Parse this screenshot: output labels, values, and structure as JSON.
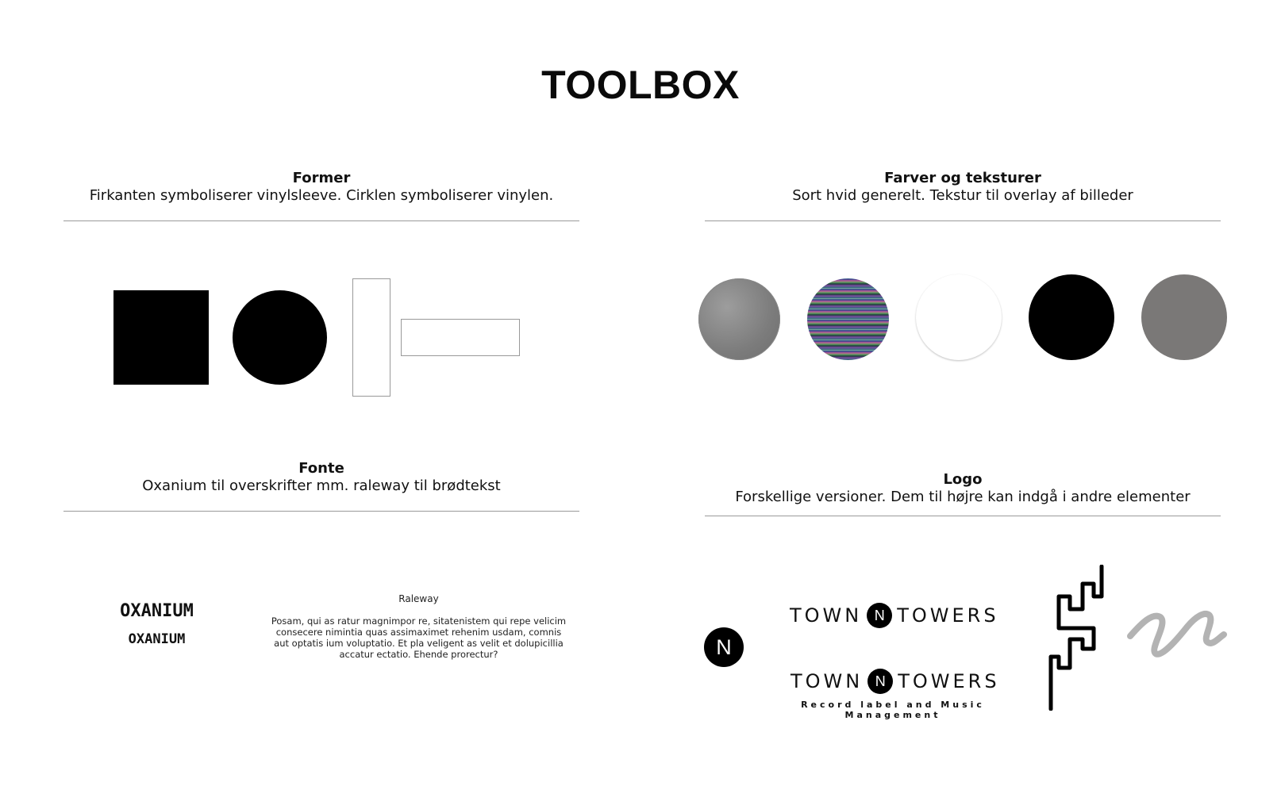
{
  "page_title": "TOOLBOX",
  "sections": {
    "former": {
      "heading": "Former",
      "description": "Firkanten symboliserer vinylsleeve. Cirklen symboliserer vinylen."
    },
    "farver": {
      "heading": "Farver og teksturer",
      "description": "Sort hvid generelt. Tekstur til overlay af billeder",
      "swatches": [
        {
          "name": "grey-texture",
          "color": "#8a8a8a"
        },
        {
          "name": "glitch-texture",
          "color": "#4a7a90"
        },
        {
          "name": "white",
          "color": "#ffffff"
        },
        {
          "name": "black",
          "color": "#000000"
        },
        {
          "name": "grey",
          "color": "#7a7877"
        }
      ]
    },
    "fonte": {
      "heading": "Fonte",
      "description": "Oxanium til overskrifter mm. raleway til brødtekst",
      "oxanium_large": "OXANIUM",
      "oxanium_small": "OXANIUM",
      "raleway_label": "Raleway",
      "raleway_sample": "Posam, qui as ratur magnimpor re, sitatenistem qui repe velicim consecere nimintia quas assimaximet rehenim usdam, comnis aut optatis ium voluptatio. Et pla veligent as velit et dolupicillia accatur ectatio. Ehende prorectur?"
    },
    "logo": {
      "heading": "Logo",
      "description": "Forskellige versioner. Dem til højre kan indgå i andre elementer",
      "icon_letter": "N",
      "word_left": "TOWN",
      "word_right": "TOWERS",
      "tagline": "Record label and Music Management"
    }
  }
}
